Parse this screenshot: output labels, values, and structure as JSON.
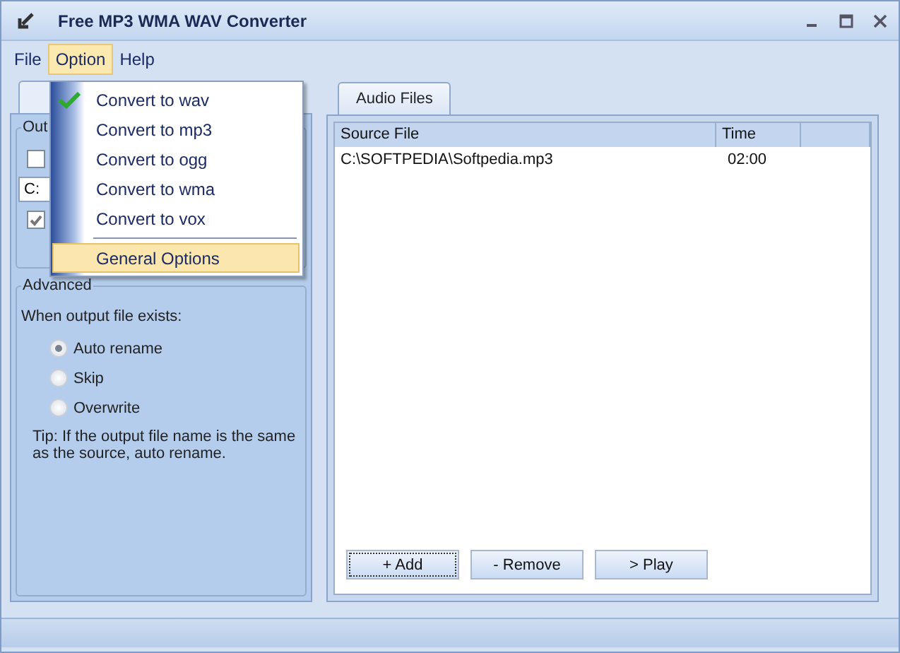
{
  "window": {
    "title": "Free MP3 WMA WAV Converter"
  },
  "menu_bar": [
    {
      "label": "File",
      "selected": false
    },
    {
      "label": "Option",
      "selected": true
    },
    {
      "label": "Help",
      "selected": false
    }
  ],
  "option_menu": [
    {
      "kind": "item",
      "label": "Convert to wav",
      "checked": true,
      "selected": false
    },
    {
      "kind": "item",
      "label": "Convert to mp3",
      "checked": false,
      "selected": false
    },
    {
      "kind": "item",
      "label": "Convert to ogg",
      "checked": false,
      "selected": false
    },
    {
      "kind": "item",
      "label": "Convert to wma",
      "checked": false,
      "selected": false
    },
    {
      "kind": "item",
      "label": "Convert to vox",
      "checked": false,
      "selected": false
    },
    {
      "kind": "separator"
    },
    {
      "kind": "item",
      "label": "General Options",
      "checked": false,
      "selected": true
    }
  ],
  "output_group": {
    "title": "Out",
    "option_checkbox": {
      "checked": false
    },
    "folder_field": {
      "value": "C:"
    },
    "second_checkbox": {
      "checked": true
    }
  },
  "advanced_group": {
    "title": "Advanced",
    "prompt": "When output file exists:",
    "options": [
      {
        "label": "Auto rename",
        "selected": true
      },
      {
        "label": "Skip",
        "selected": false
      },
      {
        "label": "Overwrite",
        "selected": false
      }
    ],
    "tip": "Tip: If the output file name is the same as the source, auto rename."
  },
  "file_tabs": [
    {
      "label": "Audio Files",
      "selected": true
    }
  ],
  "file_table": {
    "columns": [
      "Source File",
      "Time"
    ],
    "rows": [
      [
        "C:\\SOFTPEDIA\\Softpedia.mp3",
        "02:00"
      ]
    ]
  },
  "buttons": [
    "+ Add",
    "- Remove",
    "> Play"
  ]
}
